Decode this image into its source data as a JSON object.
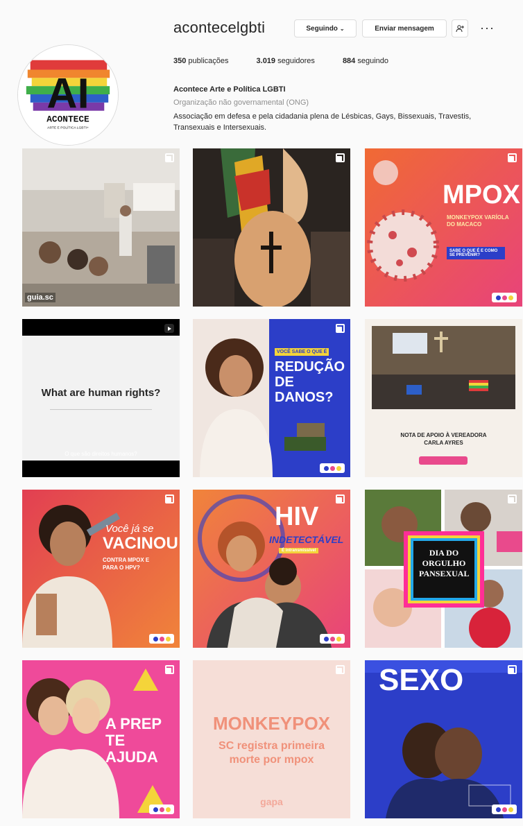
{
  "profile": {
    "username": "acontecelgbti",
    "follow_button": "Seguindo",
    "message_button": "Enviar mensagem",
    "more_label": "···",
    "stats": {
      "posts_count": "350",
      "posts_label": "publicações",
      "followers_count": "3.019",
      "followers_label": "seguidores",
      "following_count": "884",
      "following_label": "seguindo"
    },
    "display_name": "Acontece Arte e Política LGBTI",
    "category": "Organização não governamental (ONG)",
    "bio": "Associação em defesa e pela cidadania plena de Lésbicas, Gays, Bissexuais, Travestis, Transexuais e Intersexuais."
  },
  "avatar": {
    "logo_text": "AI",
    "logo_word": "ACONTECE",
    "logo_tagline": "ARTE E POLÍTICA LGBTI+"
  },
  "posts": [
    {
      "id": "post-1",
      "caption_visible": "guia.sc"
    },
    {
      "id": "post-2",
      "caption_visible": ""
    },
    {
      "id": "post-3",
      "headline": "MPOX",
      "subline": "MONKEYPOX VARÍOLA DO MACACO",
      "cta": "SABE O QUE É E COMO SE PREVENIR?"
    },
    {
      "id": "post-4",
      "headline": "What are human rights?",
      "subline": "O que são direitos humanos?"
    },
    {
      "id": "post-5",
      "kicker": "VOCÊ SABE O QUE É",
      "headline": "REDUÇÃO DE DANOS?"
    },
    {
      "id": "post-6",
      "headline": "NOTA DE APOIO À VEREADORA CARLA AYRES"
    },
    {
      "id": "post-7",
      "kicker": "Você já se",
      "headline": "VACINOU",
      "subline": "CONTRA MPOX E PARA O HPV?"
    },
    {
      "id": "post-8",
      "headline": "HIV",
      "subline": "INDETECTÁVEL",
      "cta": "É intransmissível"
    },
    {
      "id": "post-9",
      "headline": "DIA DO ORGULHO PANSEXUAL"
    },
    {
      "id": "post-10",
      "headline": "A PREP TE AJUDA"
    },
    {
      "id": "post-11",
      "headline": "MONKEYPOX",
      "subline": "SC registra primeira morte por mpox",
      "footer": "gapa"
    },
    {
      "id": "post-12",
      "headline": "SEXO"
    }
  ],
  "colors": {
    "accent_orange": "#f26a3a",
    "accent_blue": "#2c3ec8",
    "accent_pink": "#e94a8c",
    "text_muted": "#8e8e8e"
  }
}
